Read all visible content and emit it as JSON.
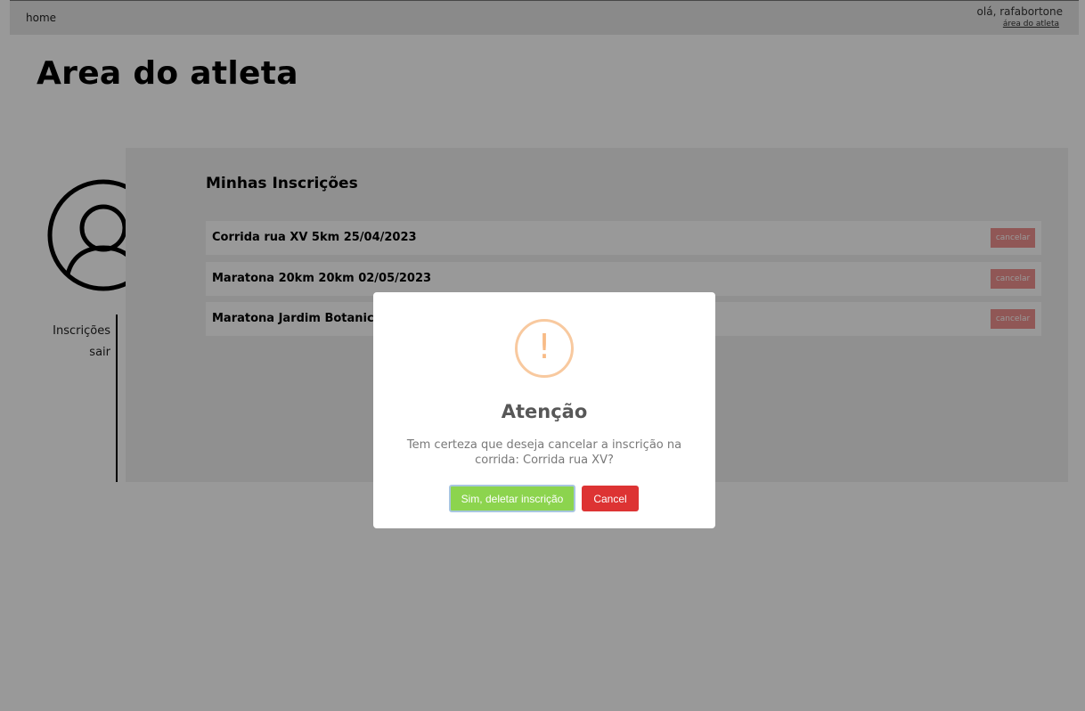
{
  "nav": {
    "home": "home",
    "greeting": "olá, rafabortone",
    "athlete_area_link": "área do atleta"
  },
  "page": {
    "title": "Area do atleta"
  },
  "sidebar": {
    "items": [
      {
        "label": "Inscrições"
      },
      {
        "label": "sair"
      }
    ]
  },
  "main": {
    "title": "Minhas Inscrições",
    "registrations": [
      {
        "label": "Corrida rua XV 5km 25/04/2023",
        "cancel": "cancelar"
      },
      {
        "label": "Maratona 20km 20km 02/05/2023",
        "cancel": "cancelar"
      },
      {
        "label": "Maratona Jardim Botanico",
        "cancel": "cancelar"
      }
    ]
  },
  "modal": {
    "icon": "!",
    "title": "Atenção",
    "text": "Tem certeza que deseja cancelar a inscrição na corrida: Corrida rua XV?",
    "confirm": "Sim, deletar inscrição",
    "cancel": "Cancel"
  },
  "colors": {
    "confirm": "#8cd44e",
    "cancel": "#dd3333",
    "warning": "#f8bb86",
    "cancel_item": "#f0928f"
  }
}
